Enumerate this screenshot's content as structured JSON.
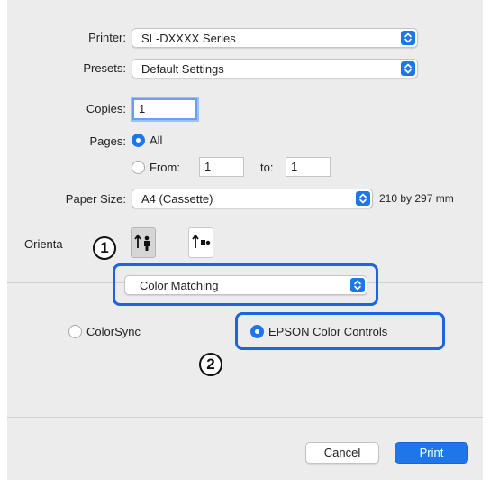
{
  "printer": {
    "label": "Printer:",
    "value": "SL-DXXXX Series"
  },
  "presets": {
    "label": "Presets:",
    "value": "Default Settings"
  },
  "copies": {
    "label": "Copies:",
    "value": "1"
  },
  "pages": {
    "label": "Pages:",
    "all_label": "All",
    "all_selected": true,
    "from_label": "From:",
    "from_value": "1",
    "to_label": "to:",
    "to_value": "1"
  },
  "paper_size": {
    "label": "Paper Size:",
    "value": "A4 (Cassette)",
    "dimensions": "210 by 297 mm"
  },
  "orientation": {
    "label": "Orienta",
    "options": [
      "portrait",
      "landscape"
    ],
    "selected": "portrait"
  },
  "section": {
    "value": "Color Matching"
  },
  "color_options": {
    "colorsync_label": "ColorSync",
    "epson_label": "EPSON Color Controls",
    "selected": "EPSON Color Controls"
  },
  "markers": {
    "one": "1",
    "two": "2"
  },
  "buttons": {
    "cancel_label": "Cancel",
    "print_label": "Print"
  },
  "colors": {
    "accent": "#1f76e8",
    "callout": "#1e63df",
    "dialog_bg": "#ececec"
  }
}
